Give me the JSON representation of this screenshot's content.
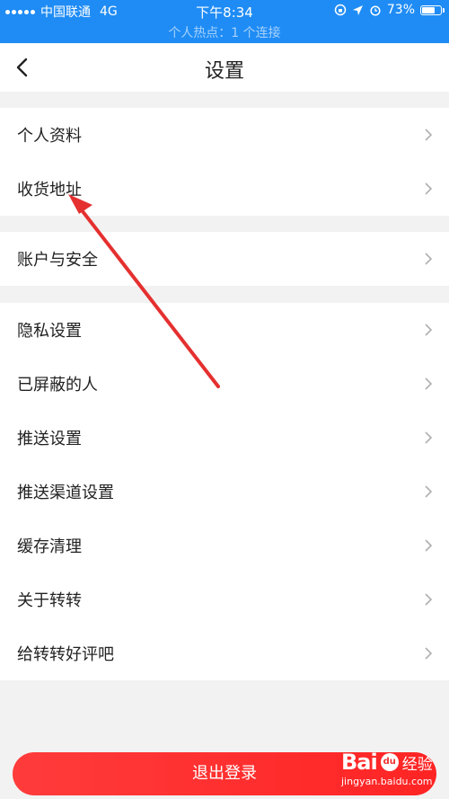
{
  "status_bar": {
    "carrier": "中国联通",
    "network": "4G",
    "time": "下午8:34",
    "battery": "73%",
    "battery_level": 0.73,
    "hotspot": "个人热点：1 个连接"
  },
  "nav": {
    "title": "设置",
    "back_icon": "chevron-left-icon"
  },
  "groups": [
    [
      "个人资料",
      "收货地址"
    ],
    [
      "账户与安全"
    ],
    [
      "隐私设置",
      "已屏蔽的人",
      "推送设置",
      "推送渠道设置",
      "缓存清理",
      "关于转转",
      "给转转好评吧"
    ]
  ],
  "logout_label": "退出登录",
  "watermark": {
    "logo": "Bai",
    "paw": "du",
    "text": "经验",
    "url": "jingyan.baidu.com"
  },
  "colors": {
    "accent": "#1f8cf5",
    "danger": "#ff3030",
    "annotation_arrow": "#e53030"
  }
}
